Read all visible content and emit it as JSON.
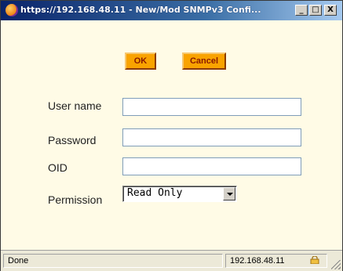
{
  "window": {
    "title": "https://192.168.48.11 - New/Mod SNMPv3 Confi...",
    "minimize_label": "_",
    "maximize_label": "□",
    "close_label": "X"
  },
  "buttons": {
    "ok": "OK",
    "cancel": "Cancel"
  },
  "form": {
    "user_name_label": "User name",
    "user_name_value": "",
    "password_label": "Password",
    "password_value": "",
    "oid_label": "OID",
    "oid_value": "",
    "permission_label": "Permission",
    "permission_value": "Read Only"
  },
  "status": {
    "text": "Done",
    "host": "192.168.48.11"
  },
  "colors": {
    "button_bg": "#f9a300",
    "button_text": "#8a1a00",
    "content_bg": "#fffbe6",
    "titlebar": "#0a246a"
  }
}
